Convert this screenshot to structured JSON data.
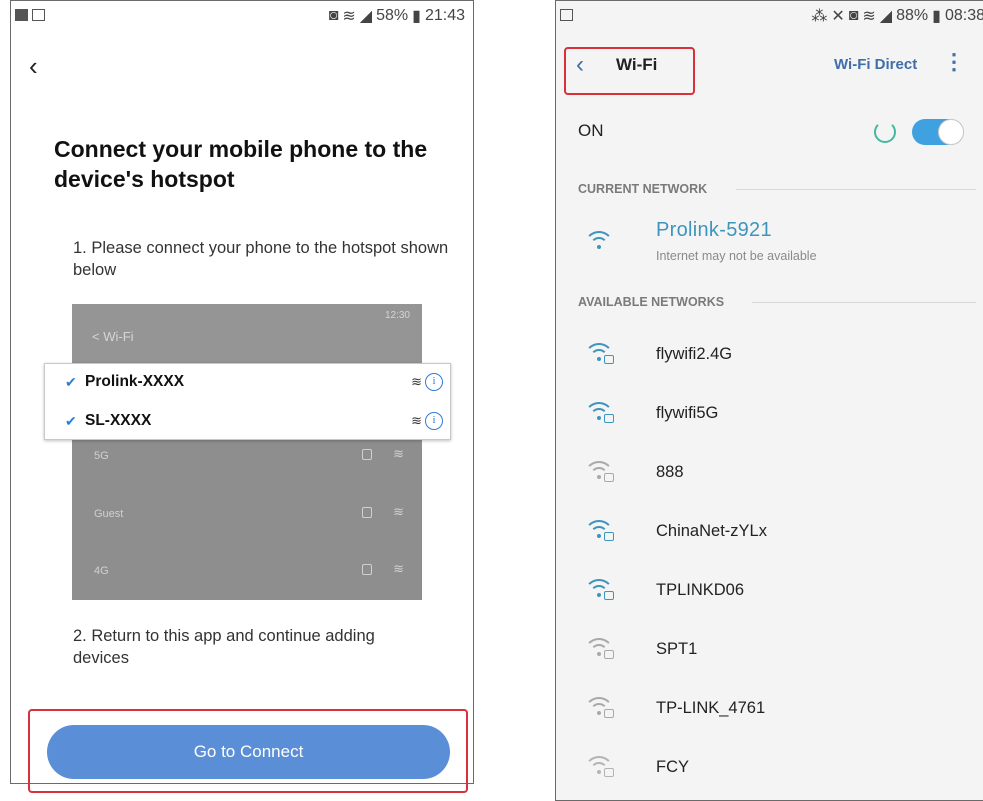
{
  "left": {
    "status_time": "21:43",
    "status_battery": "58%",
    "title": "Connect your mobile phone to the device's hotspot",
    "step1": "1. Please connect your phone to the hotspot shown below",
    "illustration": {
      "time": "12:30",
      "wifi_label": "< Wi-Fi",
      "highlighted": [
        "Prolink-XXXX",
        "SL-XXXX"
      ],
      "other": [
        "5G",
        "Guest",
        "4G"
      ]
    },
    "step2": "2. Return to this app and continue adding devices",
    "connect_button": "Go to Connect"
  },
  "right": {
    "status_time": "08:38",
    "status_battery": "88%",
    "title": "Wi-Fi",
    "wifi_direct": "Wi-Fi Direct",
    "more": "⋮",
    "on_label": "ON",
    "current_section": "CURRENT NETWORK",
    "current": {
      "name": "Prolink-5921",
      "status": "Internet may not be available"
    },
    "available_section": "AVAILABLE NETWORKS",
    "networks": [
      "flywifi2.4G",
      "flywifi5G",
      "888",
      "ChinaNet-zYLx",
      "TPLINKD06",
      "SPT1",
      "TP-LINK_4761",
      "FCY"
    ]
  },
  "colors": {
    "accent_blue": "#5a8ed6",
    "highlight_red": "#d9303b",
    "wifi_text": "#3d95bd",
    "toggle": "#3fa1e0"
  }
}
